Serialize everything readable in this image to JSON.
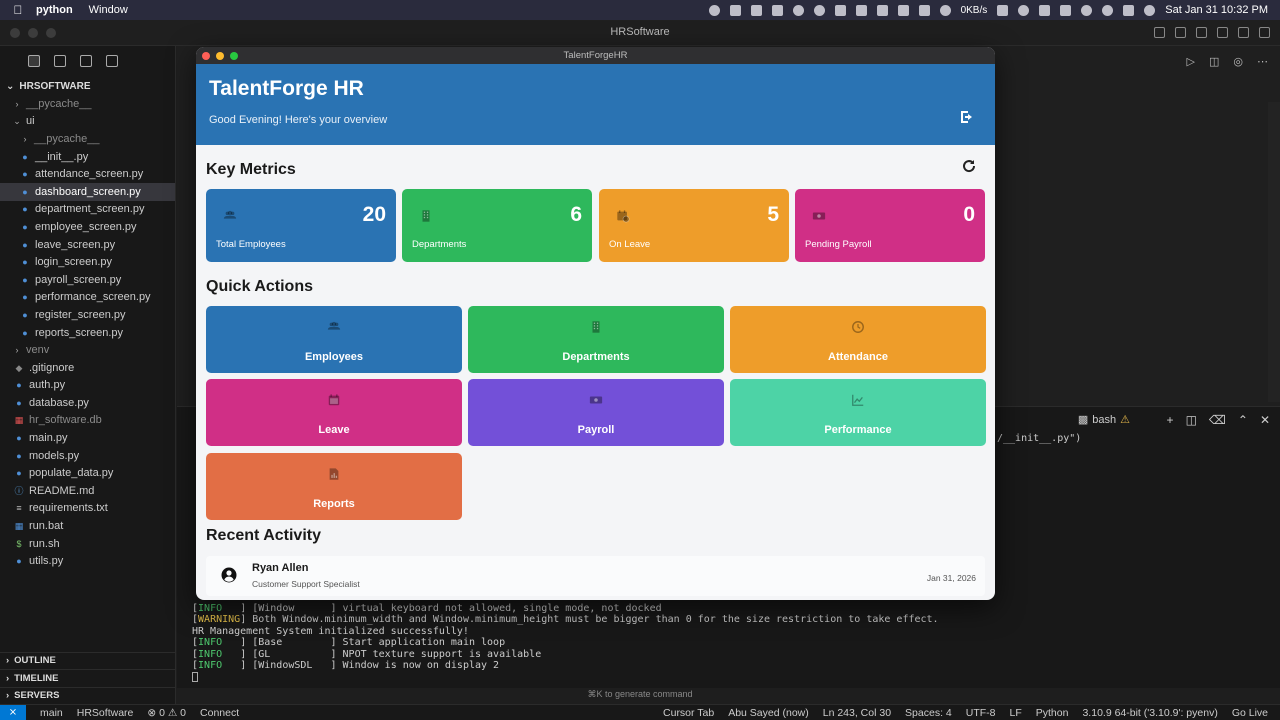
{
  "menubar": {
    "app_name": "python",
    "menu_window": "Window",
    "net_speed": "0KB/s",
    "clock": "Sat Jan 31  10:32 PM"
  },
  "vscode": {
    "title": "HRSoftware",
    "explorer_root": "HRSOFTWARE",
    "tree": [
      {
        "label": "__pycache__",
        "indent": 1,
        "type": "folder",
        "dim": true
      },
      {
        "label": "ui",
        "indent": 1,
        "type": "folder-open"
      },
      {
        "label": "__pycache__",
        "indent": 2,
        "type": "folder",
        "dim": true
      },
      {
        "label": "__init__.py",
        "indent": 2,
        "type": "py"
      },
      {
        "label": "attendance_screen.py",
        "indent": 2,
        "type": "py"
      },
      {
        "label": "dashboard_screen.py",
        "indent": 2,
        "type": "py",
        "selected": true
      },
      {
        "label": "department_screen.py",
        "indent": 2,
        "type": "py"
      },
      {
        "label": "employee_screen.py",
        "indent": 2,
        "type": "py"
      },
      {
        "label": "leave_screen.py",
        "indent": 2,
        "type": "py"
      },
      {
        "label": "login_screen.py",
        "indent": 2,
        "type": "py"
      },
      {
        "label": "payroll_screen.py",
        "indent": 2,
        "type": "py"
      },
      {
        "label": "performance_screen.py",
        "indent": 2,
        "type": "py"
      },
      {
        "label": "register_screen.py",
        "indent": 2,
        "type": "py"
      },
      {
        "label": "reports_screen.py",
        "indent": 2,
        "type": "py"
      },
      {
        "label": "venv",
        "indent": 1,
        "type": "folder",
        "dim": true
      },
      {
        "label": ".gitignore",
        "indent": 1,
        "type": "git"
      },
      {
        "label": "auth.py",
        "indent": 1,
        "type": "py"
      },
      {
        "label": "database.py",
        "indent": 1,
        "type": "py"
      },
      {
        "label": "hr_software.db",
        "indent": 1,
        "type": "db",
        "dim": true
      },
      {
        "label": "main.py",
        "indent": 1,
        "type": "py"
      },
      {
        "label": "models.py",
        "indent": 1,
        "type": "py"
      },
      {
        "label": "populate_data.py",
        "indent": 1,
        "type": "py"
      },
      {
        "label": "README.md",
        "indent": 1,
        "type": "md"
      },
      {
        "label": "requirements.txt",
        "indent": 1,
        "type": "txt"
      },
      {
        "label": "run.bat",
        "indent": 1,
        "type": "bat"
      },
      {
        "label": "run.sh",
        "indent": 1,
        "type": "sh"
      },
      {
        "label": "utils.py",
        "indent": 1,
        "type": "py"
      }
    ],
    "footer_sections": [
      "OUTLINE",
      "TIMELINE",
      "SERVERS"
    ],
    "terminal_tab": "bash",
    "terminal_fragment": "/__init__.py\")",
    "terminal_lines": [
      {
        "tag": "INFO",
        "tag_pad": "INFO   ",
        "text": "] [Window      ] virtual keyboard not allowed, single mode, not docked"
      },
      {
        "tag": "WARNING",
        "tag_pad": "WARNING",
        "text": "] Both Window.minimum_width and Window.minimum_height must be bigger than 0 for the size restriction to take effect."
      },
      {
        "tag": "",
        "tag_pad": "",
        "text": "HR Management System initialized successfully!"
      },
      {
        "tag": "INFO",
        "tag_pad": "INFO   ",
        "text": "] [Base        ] Start application main loop"
      },
      {
        "tag": "INFO",
        "tag_pad": "INFO   ",
        "text": "] [GL          ] NPOT texture support is available"
      },
      {
        "tag": "INFO",
        "tag_pad": "INFO   ",
        "text": "] [WindowSDL   ] Window is now on display 2"
      }
    ],
    "cmd_hint": "⌘K to generate command",
    "status": {
      "branch": "main",
      "project": "HRSoftware",
      "problems": "⊗ 0 ⚠ 0",
      "connect": "Connect",
      "cursor_tab": "Cursor Tab",
      "author": "Abu Sayed (now)",
      "position": "Ln 243, Col 30",
      "spaces": "Spaces: 4",
      "encoding": "UTF-8",
      "eol": "LF",
      "language": "Python",
      "interpreter": "3.10.9 64-bit ('3.10.9': pyenv)",
      "golive": "Go Live"
    }
  },
  "app": {
    "window_title": "TalentForgeHR",
    "header_title": "TalentForge HR",
    "header_subtitle": "Good Evening! Here's your overview",
    "key_metrics_title": "Key Metrics",
    "metrics": [
      {
        "label": "Total Employees",
        "value": "20",
        "color": "#2a73b3",
        "icon": "users-icon"
      },
      {
        "label": "Departments",
        "value": "6",
        "color": "#2eb85c",
        "icon": "building-icon"
      },
      {
        "label": "On Leave",
        "value": "5",
        "color": "#ee9d2a",
        "icon": "calendar-clock-icon"
      },
      {
        "label": "Pending Payroll",
        "value": "0",
        "color": "#d02f86",
        "icon": "money-icon"
      }
    ],
    "quick_actions_title": "Quick Actions",
    "actions": [
      {
        "label": "Employees",
        "color": "#2a73b3",
        "icon": "users-icon"
      },
      {
        "label": "Departments",
        "color": "#2eb85c",
        "icon": "building-icon"
      },
      {
        "label": "Attendance",
        "color": "#ee9d2a",
        "icon": "clock-icon"
      },
      {
        "label": "Leave",
        "color": "#d02f86",
        "icon": "calendar-icon"
      },
      {
        "label": "Payroll",
        "color": "#7350d8",
        "icon": "money-icon"
      },
      {
        "label": "Performance",
        "color": "#4dd3a6",
        "icon": "chart-line-icon"
      },
      {
        "label": "Reports",
        "color": "#e26e45",
        "icon": "file-chart-icon"
      }
    ],
    "recent_activity_title": "Recent Activity",
    "activity": [
      {
        "name": "Ryan Allen",
        "role": "Customer Support Specialist",
        "date": "Jan 31, 2026"
      }
    ]
  }
}
